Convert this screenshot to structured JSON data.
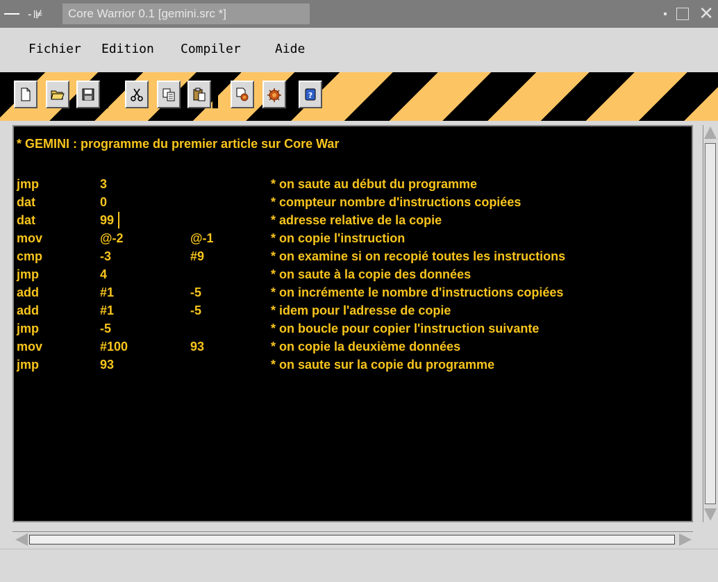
{
  "window": {
    "title": "Core Warrior 0.1 [gemini.src *]"
  },
  "menu": {
    "items": [
      "Fichier",
      "Edition",
      "Compiler",
      "Aide"
    ]
  },
  "toolbar": {
    "buttons": [
      {
        "name": "new-file-icon"
      },
      {
        "name": "open-folder-icon"
      },
      {
        "name": "save-icon"
      },
      {
        "name": "cut-icon"
      },
      {
        "name": "copy-icon"
      },
      {
        "name": "paste-icon"
      },
      {
        "name": "compile-icon"
      },
      {
        "name": "run-icon"
      },
      {
        "name": "about-icon"
      }
    ]
  },
  "editor": {
    "header": "* GEMINI : programme du premier article sur Core War",
    "lines": [
      {
        "op": "jmp",
        "a": "3",
        "b": "",
        "comment": "* on saute au début du programme"
      },
      {
        "op": "dat",
        "a": "0",
        "b": "",
        "comment": "* compteur nombre d'instructions copiées"
      },
      {
        "op": "dat",
        "a": "99",
        "b": "",
        "comment": "* adresse relative de la copie"
      },
      {
        "op": "mov",
        "a": "@-2",
        "b": "@-1",
        "comment": "* on copie l'instruction"
      },
      {
        "op": "cmp",
        "a": "-3",
        "b": "#9",
        "comment": "* on examine si on recopié toutes les instructions"
      },
      {
        "op": "jmp",
        "a": "4",
        "b": "",
        "comment": "* on saute à la copie des données"
      },
      {
        "op": "add",
        "a": "#1",
        "b": "-5",
        "comment": "* on incrémente le nombre d'instructions copiées"
      },
      {
        "op": "add",
        "a": "#1",
        "b": "-5",
        "comment": "* idem pour l'adresse de copie"
      },
      {
        "op": "jmp",
        "a": "-5",
        "b": "",
        "comment": "* on boucle pour copier l'instruction suivante"
      },
      {
        "op": "mov",
        "a": "#100",
        "b": "93",
        "comment": "* on copie la deuxième données"
      },
      {
        "op": "jmp",
        "a": "93",
        "b": "",
        "comment": "* on saute sur la copie du programme"
      }
    ],
    "colors": {
      "background": "#000000",
      "text": "#f9c51d"
    }
  },
  "colors": {
    "toolbar_stripe": "#fdc463",
    "chrome": "#d9d9d9"
  }
}
